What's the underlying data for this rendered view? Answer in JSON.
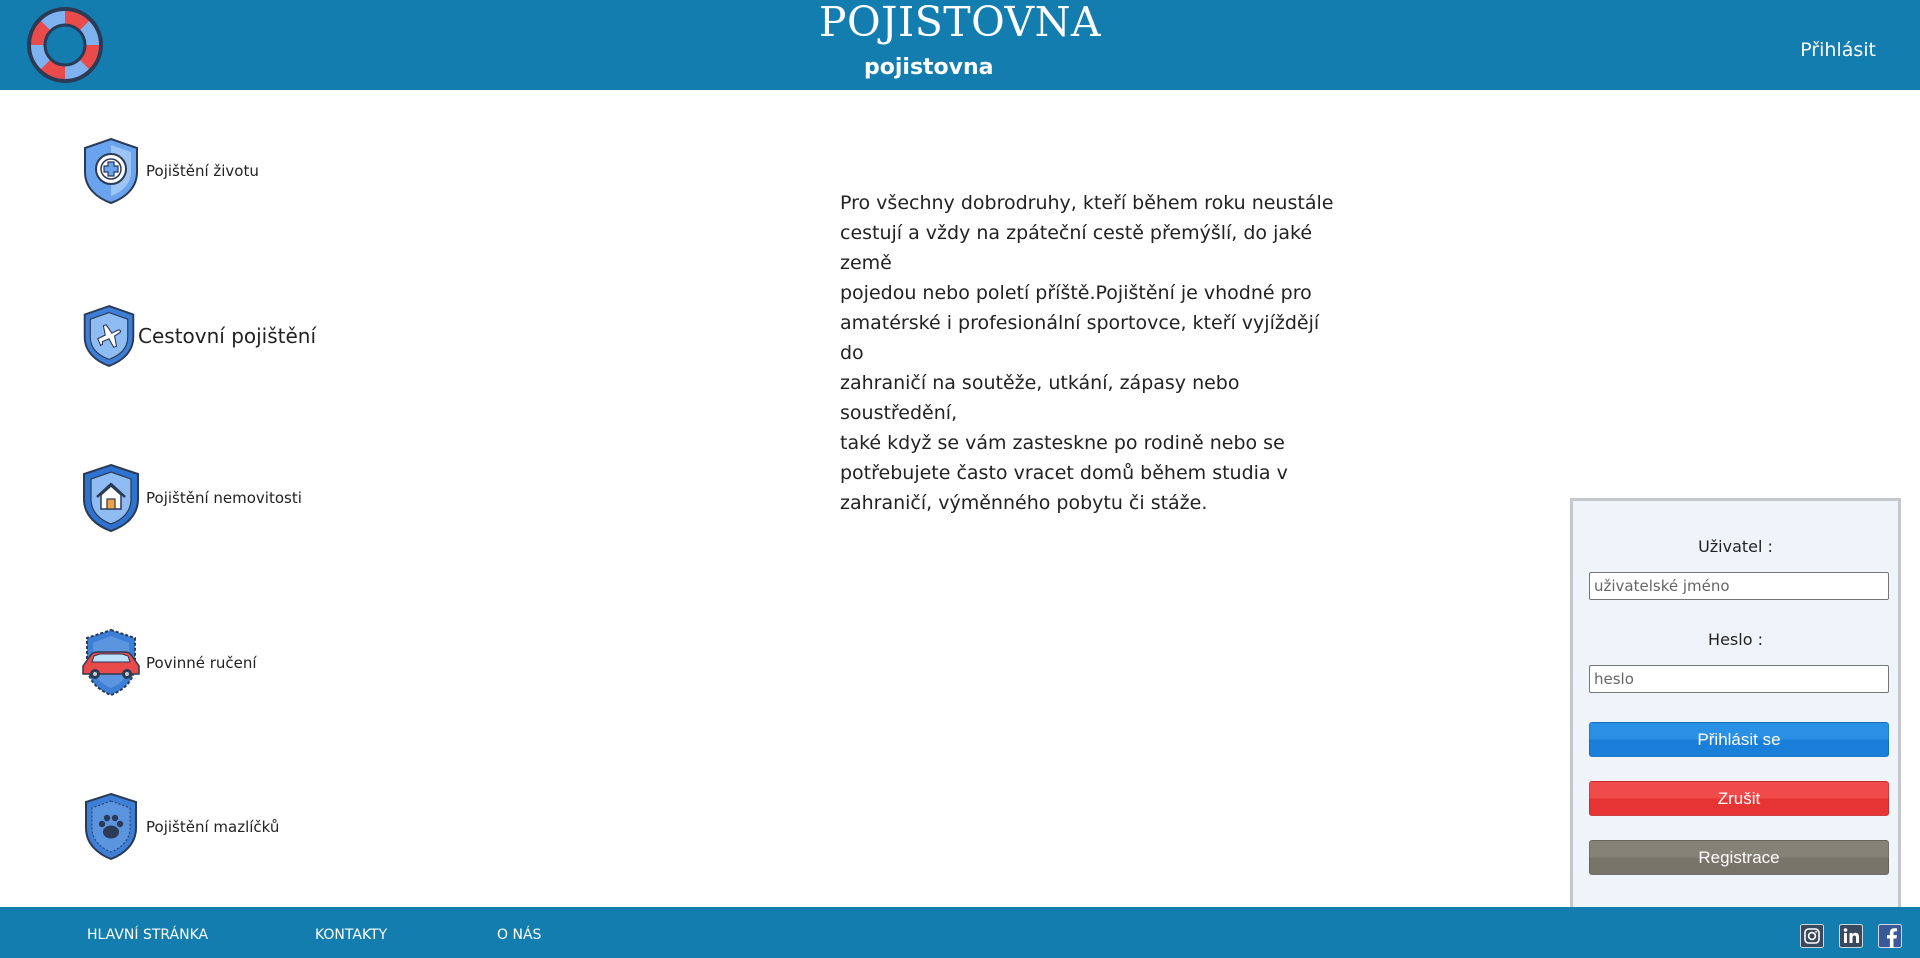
{
  "header": {
    "title": "POJISTOVNA",
    "subtitle": "pojistovna",
    "login_link": "Přihlásit",
    "logo_icon": "lifebuoy-icon"
  },
  "sidebar": {
    "items": [
      {
        "label": "Pojištění životu",
        "icon": "shield-medical-icon"
      },
      {
        "label": "Cestovní pojištění",
        "icon": "shield-airplane-icon"
      },
      {
        "label": "Pojištění nemovitosti",
        "icon": "shield-house-icon"
      },
      {
        "label": "Povinné ručení",
        "icon": "shield-car-icon"
      },
      {
        "label": "Pojištění mazlíčků",
        "icon": "shield-paw-icon"
      }
    ]
  },
  "main": {
    "description_lines": [
      "Pro všechny dobrodruhy, kteří během roku neustále",
      "cestují a vždy na zpáteční cestě přemýšlí, do jaké země",
      "pojedou nebo poletí příště.Pojištění je vhodné pro",
      "amatérské i profesionální sportovce, kteří vyjíždějí do",
      "zahraničí na soutěže, utkání, zápasy nebo soustředění,",
      "také když se vám zasteskne po rodině nebo se",
      "potřebujete často vracet domů během studia v",
      "zahraničí, výměnného pobytu či stáže."
    ]
  },
  "login_form": {
    "user_label": "Uživatel :",
    "user_placeholder": "uživatelské jméno",
    "password_label": "Heslo :",
    "password_placeholder": "heslo",
    "login_button": "Přihlásit se",
    "cancel_button": "Zrušit",
    "register_button": "Registrace"
  },
  "footer": {
    "links": [
      "HLAVNÍ STRÁNKA",
      "KONTAKTY",
      "O NÁS"
    ],
    "social_icons": [
      "instagram-icon",
      "linkedin-icon",
      "facebook-icon"
    ]
  },
  "colors": {
    "header_bg": "#137daf",
    "login_button": "#1a7fd8",
    "cancel_button": "#e63434",
    "register_button": "#7a786d"
  }
}
